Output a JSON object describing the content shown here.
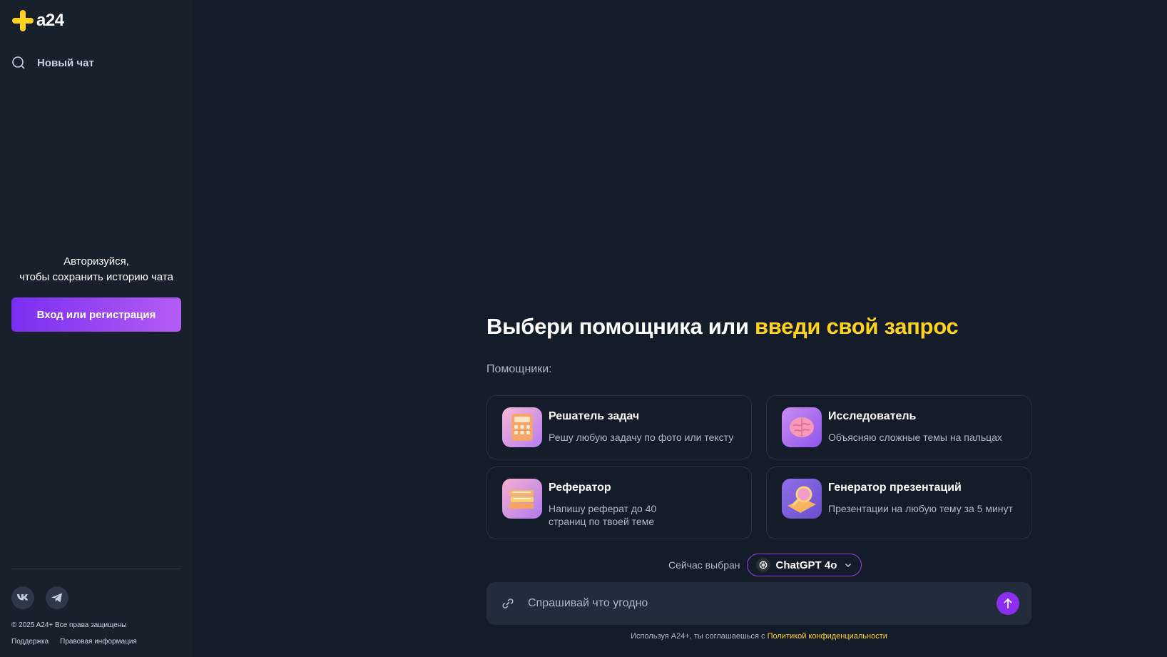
{
  "brand": {
    "logo_text": "a24",
    "accent": "#ffd21f",
    "primary": "#8a2ef0"
  },
  "sidebar": {
    "new_chat_label": "Новый чат",
    "new_chat_icon": "search-icon",
    "auth_line1": "Авторизуйся,",
    "auth_line2": "чтобы сохранить историю чата",
    "auth_button": "Вход или регистрация",
    "socials": [
      {
        "icon": "vk-icon"
      },
      {
        "icon": "telegram-icon"
      }
    ],
    "copyright": "© 2025 A24+ Все права защищены",
    "footer_links": [
      "Поддержка",
      "Правовая информация"
    ]
  },
  "main": {
    "headline_part1": "Выбери помощника или ",
    "headline_accent": "введи свой запрос",
    "helpers_label": "Помощники:",
    "helpers": [
      {
        "title": "Решатель задач",
        "desc": "Решу любую задачу по фото или тексту",
        "icon": "calculator-icon"
      },
      {
        "title": "Исследователь",
        "desc": "Объясняю сложные темы на пальцах",
        "icon": "brain-icon"
      },
      {
        "title": "Рефератор",
        "desc": "Напишу реферат до 40 страниц по твоей теме",
        "icon": "books-icon"
      },
      {
        "title": "Генератор презентаций",
        "desc": "Презентации на любую тему за 5 минут",
        "icon": "magnifier-icon"
      }
    ],
    "model_label": "Сейчас выбран",
    "model_name": "ChatGPT 4o",
    "input_placeholder": "Спрашивай что угодно",
    "legal_text": "Используя A24+, ты соглашаешься с ",
    "legal_link": "Политикой конфиденциальности"
  }
}
